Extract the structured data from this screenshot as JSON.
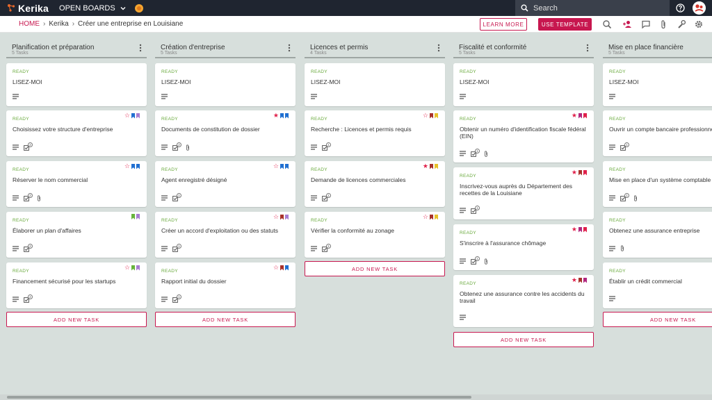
{
  "app": {
    "logo_text": "Kerika",
    "boards_menu": "OPEN BOARDS"
  },
  "search": {
    "placeholder": "Search"
  },
  "breadcrumb": {
    "home": "HOME",
    "parent": "Kerika",
    "current": "Créer une entreprise en Louisiane"
  },
  "actions": {
    "learn_more": "LEARN MORE",
    "use_template": "USE TEMPLATE"
  },
  "colors": {
    "accent": "#c7174f",
    "ready": "#67a83a",
    "blue": "#1f6fd1",
    "purple": "#a77dd1",
    "green": "#67b33b",
    "darkred": "#a8322b",
    "yellow": "#e7c12a",
    "magenta": "#b0267f",
    "red": "#e0204a"
  },
  "add_task_label": "ADD NEW TASK",
  "columns": [
    {
      "title": "Planification et préparation",
      "count": "5 Tasks",
      "cards": [
        {
          "status": "READY",
          "title": "LISEZ-MOI"
        },
        {
          "status": "READY",
          "title": "Choisissez votre structure d'entreprise",
          "checklist": "2"
        },
        {
          "status": "READY",
          "title": "Réserver le nom commercial",
          "checklist": "2"
        },
        {
          "status": "READY",
          "title": "Élaborer un plan d'affaires",
          "checklist": "2"
        },
        {
          "status": "READY",
          "title": "Financement sécurisé pour les startups",
          "checklist": "2"
        }
      ]
    },
    {
      "title": "Création d'entreprise",
      "count": "5 Tasks",
      "cards": [
        {
          "status": "READY",
          "title": "LISEZ-MOI"
        },
        {
          "status": "READY",
          "title": "Documents de constitution de dossier",
          "checklist": "2"
        },
        {
          "status": "READY",
          "title": "Agent enregistré désigné",
          "checklist": "1"
        },
        {
          "status": "READY",
          "title": "Créer un accord d'exploitation ou des statuts",
          "checklist": "1"
        },
        {
          "status": "READY",
          "title": "Rapport initial du dossier",
          "checklist": "1"
        }
      ]
    },
    {
      "title": "Licences et permis",
      "count": "4 Tasks",
      "cards": [
        {
          "status": "READY",
          "title": "LISEZ-MOI"
        },
        {
          "status": "READY",
          "title": "Recherche : Licences et permis requis",
          "checklist": "1"
        },
        {
          "status": "READY",
          "title": "Demande de licences commerciales",
          "checklist": "1"
        },
        {
          "status": "READY",
          "title": "Vérifier la conformité au zonage",
          "checklist": "1"
        }
      ]
    },
    {
      "title": "Fiscalité et conformité",
      "count": "5 Tasks",
      "cards": [
        {
          "status": "READY",
          "title": "LISEZ-MOI"
        },
        {
          "status": "READY",
          "title": "Obtenir un numéro d'identification fiscale fédéral (EIN)",
          "checklist": "1"
        },
        {
          "status": "READY",
          "title": "Inscrivez-vous auprès du Département des recettes de la Louisiane",
          "checklist": "1"
        },
        {
          "status": "READY",
          "title": "S'inscrire à l'assurance chômage",
          "checklist": "1"
        },
        {
          "status": "READY",
          "title": "Obtenez une assurance contre les accidents du travail"
        }
      ]
    },
    {
      "title": "Mise en place financière",
      "count": "5 Tasks",
      "cards": [
        {
          "status": "READY",
          "title": "LISEZ-MOI"
        },
        {
          "status": "READY",
          "title": "Ouvrir un compte bancaire professionnel",
          "checklist": "1"
        },
        {
          "status": "READY",
          "title": "Mise en place d'un système comptable",
          "checklist": "1"
        },
        {
          "status": "READY",
          "title": "Obtenez une assurance entreprise"
        },
        {
          "status": "READY",
          "title": "Établir un crédit commercial"
        }
      ]
    }
  ]
}
